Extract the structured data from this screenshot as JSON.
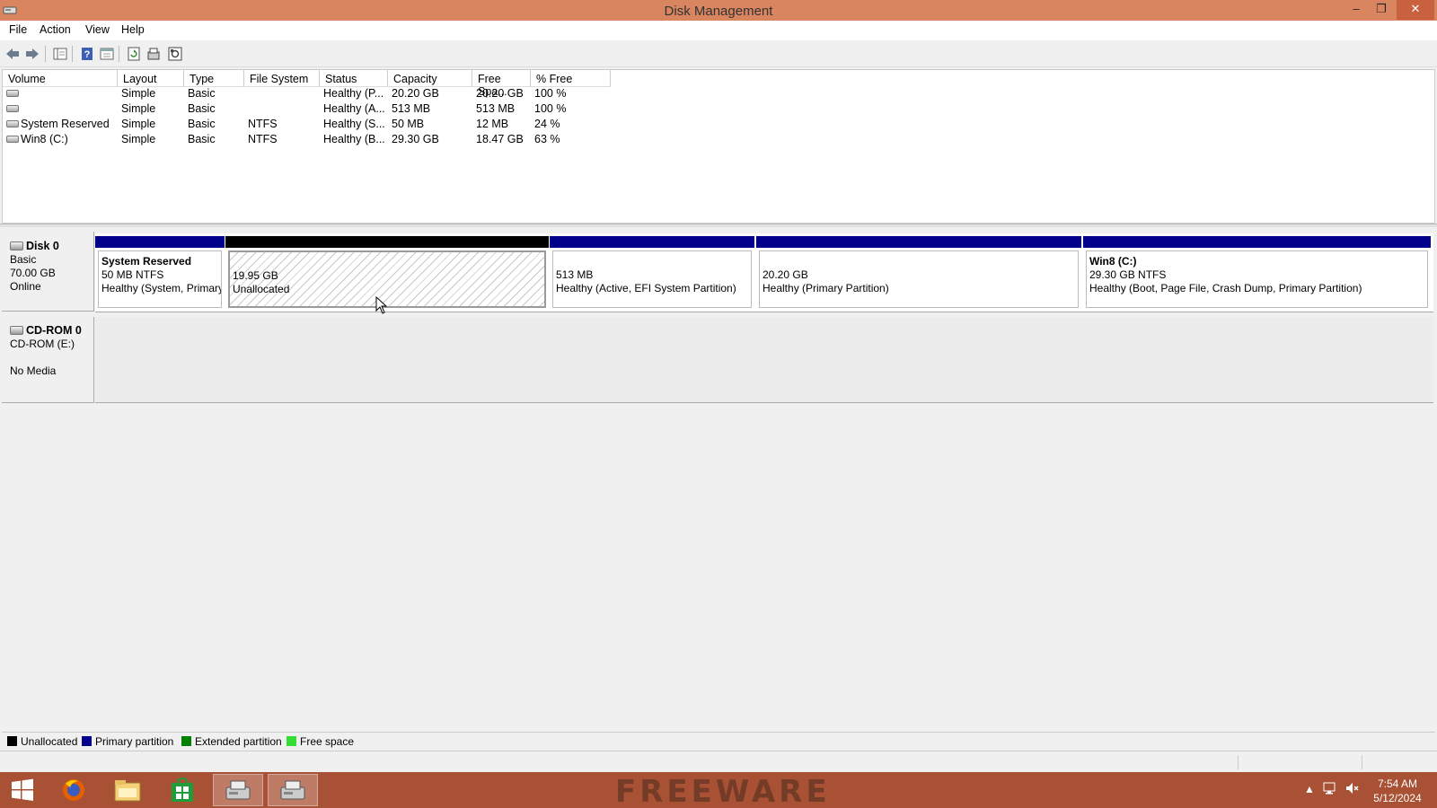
{
  "window": {
    "title": "Disk Management",
    "minimize": "–",
    "maximize": "❐",
    "close": "✕"
  },
  "menu": [
    "File",
    "Action",
    "View",
    "Help"
  ],
  "toolbar_icons": [
    "back-icon",
    "forward-icon",
    "show-hide-console-tree-icon",
    "help-icon",
    "properties-icon",
    "refresh-icon",
    "rescan-disks-icon",
    "settings-icon"
  ],
  "volume_table": {
    "columns": [
      "Volume",
      "Layout",
      "Type",
      "File System",
      "Status",
      "Capacity",
      "Free Spa...",
      "% Free"
    ],
    "rows": [
      {
        "volume": "",
        "layout": "Simple",
        "type": "Basic",
        "fs": "",
        "status": "Healthy (P...",
        "capacity": "20.20 GB",
        "free": "20.20 GB",
        "pct": "100 %"
      },
      {
        "volume": "",
        "layout": "Simple",
        "type": "Basic",
        "fs": "",
        "status": "Healthy (A...",
        "capacity": "513 MB",
        "free": "513 MB",
        "pct": "100 %"
      },
      {
        "volume": "System Reserved",
        "layout": "Simple",
        "type": "Basic",
        "fs": "NTFS",
        "status": "Healthy (S...",
        "capacity": "50 MB",
        "free": "12 MB",
        "pct": "24 %"
      },
      {
        "volume": "Win8 (C:)",
        "layout": "Simple",
        "type": "Basic",
        "fs": "NTFS",
        "status": "Healthy (B...",
        "capacity": "29.30 GB",
        "free": "18.47 GB",
        "pct": "63 %"
      }
    ]
  },
  "disk0": {
    "name": "Disk 0",
    "type": "Basic",
    "size": "70.00 GB",
    "state": "Online",
    "partitions": [
      {
        "name": "System Reserved",
        "size": "50 MB NTFS",
        "status": "Healthy (System, Primary Partition)"
      },
      {
        "name": "",
        "size": "19.95 GB",
        "status": "Unallocated"
      },
      {
        "name": "",
        "size": "513 MB",
        "status": "Healthy (Active, EFI System Partition)"
      },
      {
        "name": "",
        "size": "20.20 GB",
        "status": "Healthy (Primary Partition)"
      },
      {
        "name": "Win8  (C:)",
        "size": "29.30 GB NTFS",
        "status": "Healthy (Boot, Page File, Crash Dump, Primary Partition)"
      }
    ]
  },
  "cdrom0": {
    "name": "CD-ROM 0",
    "drive": "CD-ROM (E:)",
    "media": "No Media"
  },
  "legend": [
    "Unallocated",
    "Primary partition",
    "Extended partition",
    "Free space"
  ],
  "colors": {
    "unallocated": "#000000",
    "primary": "#00008b",
    "extended": "#008000",
    "free": "#33dd33",
    "titlebar": "#d88560",
    "taskbar": "#a85134"
  },
  "taskbar": {
    "apps": [
      "start-icon",
      "firefox-icon",
      "file-explorer-icon",
      "store-icon",
      "disk-management-icon",
      "disk-management-icon-2"
    ],
    "watermark": "FREEWARE",
    "time": "7:54 AM",
    "date": "5/12/2024"
  }
}
